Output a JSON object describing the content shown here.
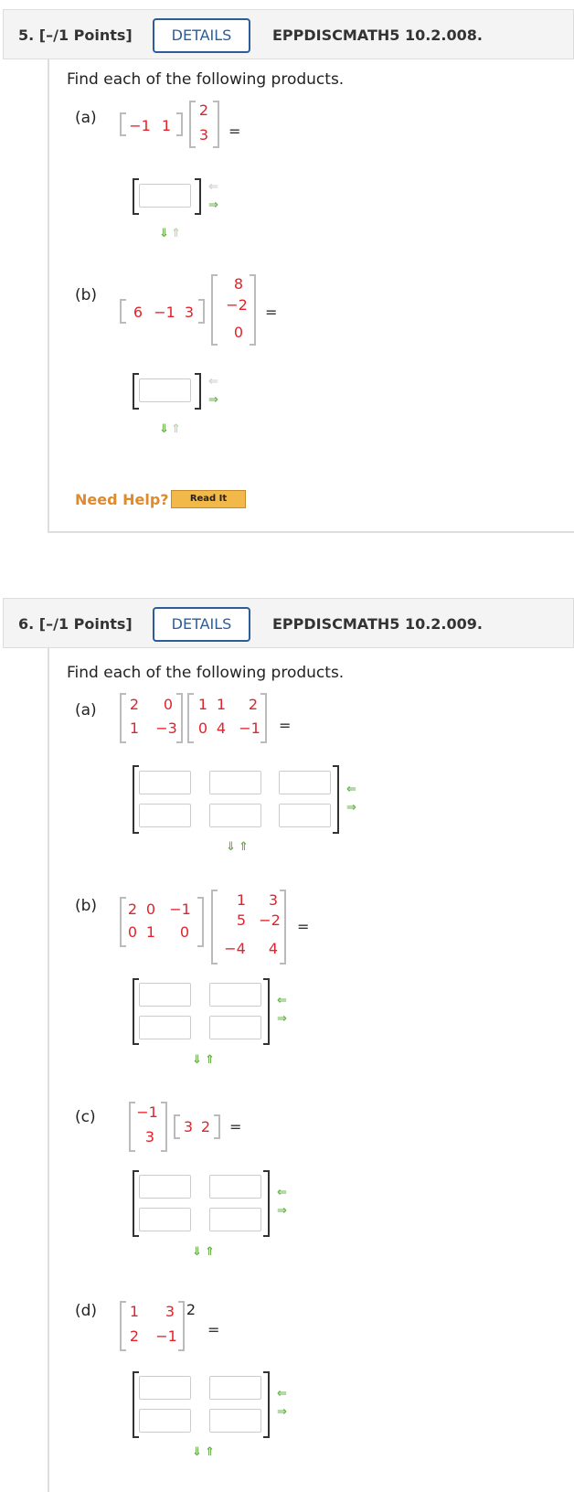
{
  "q5": {
    "points": "5. [–/1 Points]",
    "details": "DETAILS",
    "code": "EPPDISCMATH5 10.2.008.",
    "prompt": "Find each of the following products.",
    "a": {
      "label": "(a)",
      "m1": [
        "−1",
        "1"
      ],
      "m2": [
        "2",
        "3"
      ],
      "eq": "="
    },
    "b": {
      "label": "(b)",
      "m1": [
        "6",
        "−1",
        "3"
      ],
      "m2": [
        "8",
        "−2",
        "0"
      ],
      "eq": "="
    },
    "help": "Need Help?",
    "read_it": "Read It"
  },
  "q6": {
    "points": "6. [–/1 Points]",
    "details": "DETAILS",
    "code": "EPPDISCMATH5 10.2.009.",
    "prompt": "Find each of the following products.",
    "a": {
      "label": "(a)",
      "m1": [
        [
          "2",
          "0"
        ],
        [
          "1",
          "−3"
        ]
      ],
      "m2": [
        [
          "1",
          "1",
          "2"
        ],
        [
          "0",
          "4",
          "−1"
        ]
      ],
      "eq": "="
    },
    "b": {
      "label": "(b)",
      "m1": [
        [
          "2",
          "0",
          "−1"
        ],
        [
          "0",
          "1",
          "0"
        ]
      ],
      "m2": [
        [
          "1",
          "3"
        ],
        [
          "5",
          "−2"
        ],
        [
          "−4",
          "4"
        ]
      ],
      "eq": "="
    },
    "c": {
      "label": "(c)",
      "m1": [
        "−1",
        "3"
      ],
      "m2": [
        "3",
        "2"
      ],
      "eq": "="
    },
    "d": {
      "label": "(d)",
      "m1": [
        [
          "1",
          "3"
        ],
        [
          "2",
          "−1"
        ]
      ],
      "exp": "2",
      "eq": "="
    }
  },
  "icons": {
    "arrow_left": "⇐",
    "arrow_right": "⇒",
    "arrow_down": "⇓",
    "arrow_up": "⇑"
  },
  "colors": {
    "matrix_entry": "#e3222a",
    "details_border": "#2b5d99",
    "help_text": "#e08a2c",
    "arrow": "#6ab04c"
  }
}
